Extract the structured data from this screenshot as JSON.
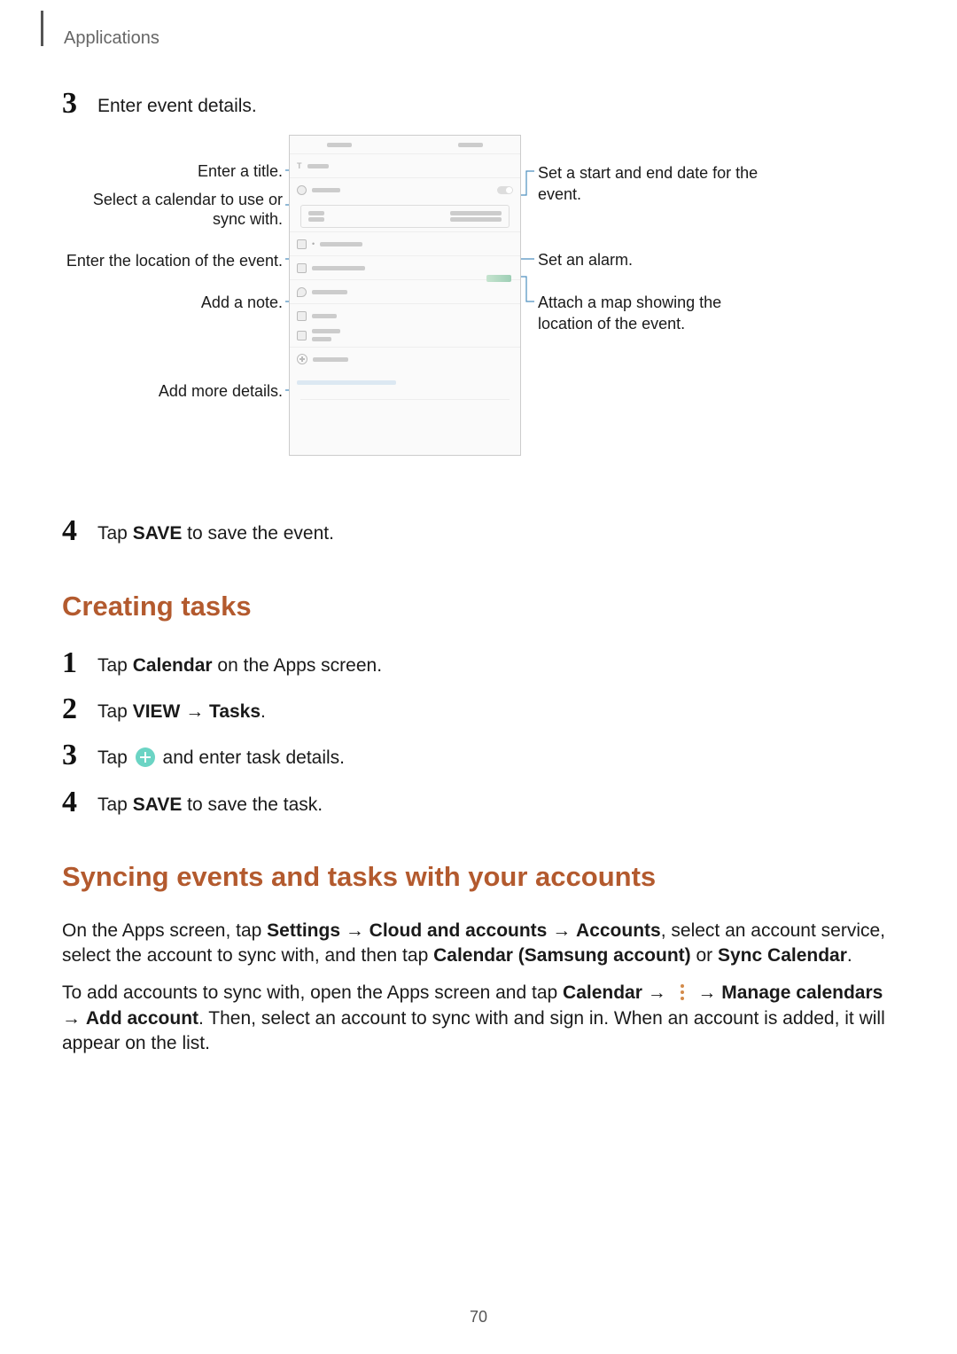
{
  "header": {
    "breadcrumb": "Applications"
  },
  "section1": {
    "step3_num": "3",
    "step3_text": "Enter event details.",
    "step4_num": "4",
    "step4_pre": "Tap ",
    "step4_bold": "SAVE",
    "step4_post": " to save the event."
  },
  "diagram": {
    "left_labels": {
      "title": "Enter a title.",
      "calendar_l1": "Select a calendar to use or",
      "calendar_l2": "sync with.",
      "location": "Enter the location of the event.",
      "note": "Add a note.",
      "details": "Add more details."
    },
    "right_labels": {
      "date_l1": "Set a start and end date for the",
      "date_l2": "event.",
      "alarm": "Set an alarm.",
      "map_l1": "Attach a map showing the",
      "map_l2": "location of the event."
    }
  },
  "creating_tasks": {
    "heading": "Creating tasks",
    "s1_num": "1",
    "s1_pre": "Tap ",
    "s1_bold": "Calendar",
    "s1_post": " on the Apps screen.",
    "s2_num": "2",
    "s2_pre": "Tap ",
    "s2_bold1": "VIEW",
    "s2_arrow": " → ",
    "s2_bold2": "Tasks",
    "s2_post": ".",
    "s3_num": "3",
    "s3_pre": "Tap ",
    "s3_post": " and enter task details.",
    "s4_num": "4",
    "s4_pre": "Tap ",
    "s4_bold": "SAVE",
    "s4_post": " to save the task."
  },
  "syncing": {
    "heading": "Syncing events and tasks with your accounts",
    "p1_a": "On the Apps screen, tap ",
    "p1_b": "Settings",
    "p1_c": " → ",
    "p1_d": "Cloud and accounts",
    "p1_e": " → ",
    "p1_f": "Accounts",
    "p1_g": ", select an account service, select the account to sync with, and then tap ",
    "p1_h": "Calendar (Samsung account)",
    "p1_i": " or ",
    "p1_j": "Sync Calendar",
    "p1_k": ".",
    "p2_a": "To add accounts to sync with, open the Apps screen and tap ",
    "p2_b": "Calendar",
    "p2_c": " → ",
    "p2_d": " → ",
    "p2_e": "Manage calendars",
    "p2_f": " → ",
    "p2_g": "Add account",
    "p2_h": ". Then, select an account to sync with and sign in. When an account is added, it will appear on the list."
  },
  "page_number": "70"
}
